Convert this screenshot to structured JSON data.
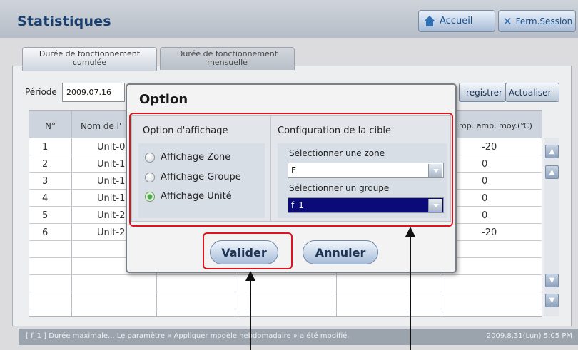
{
  "app": {
    "title": "Statistiques",
    "home_label": "Accueil",
    "logout_label": "Ferm.Session"
  },
  "tabs": [
    {
      "line1": "Durée de fonctionnement",
      "line2": "cumulée",
      "active": true
    },
    {
      "line1": "Durée de fonctionnement",
      "line2": "mensuelle",
      "active": false
    }
  ],
  "filter": {
    "period_label": "Période",
    "period_value": "2009.07.16",
    "register_label": "Enregistrer",
    "register_visible": "registrer",
    "refresh_label": "Actualiser"
  },
  "table": {
    "columns": [
      "N°",
      "Nom de l'",
      "mp. amb. moy.(℃)"
    ],
    "rows": [
      {
        "num": "1",
        "name": "Unit-0",
        "temp": "-20"
      },
      {
        "num": "2",
        "name": "Unit-1",
        "temp": "0"
      },
      {
        "num": "3",
        "name": "Unit-1",
        "temp": "0"
      },
      {
        "num": "4",
        "name": "Unit-1",
        "temp": "0"
      },
      {
        "num": "5",
        "name": "Unit-2",
        "temp": "0"
      },
      {
        "num": "6",
        "name": "Unit-2",
        "temp": "-20"
      }
    ]
  },
  "status": {
    "message": "[ f_1 ] Durée maximale... Le paramètre « Appliquer modèle hebdomadaire » a été modifié.",
    "datetime": "2009.8.31(Lun)  5:05 PM"
  },
  "modal": {
    "title": "Option",
    "display_heading": "Option d'affichage",
    "target_heading": "Configuration de la cible",
    "radios": [
      {
        "label": "Affichage Zone",
        "selected": false
      },
      {
        "label": "Affichage Groupe",
        "selected": false
      },
      {
        "label": "Affichage Unité",
        "selected": true
      }
    ],
    "zone_label": "Sélectionner une zone",
    "zone_value": "F",
    "group_label": "Sélectionner un groupe",
    "group_value": "f_1",
    "ok_label": "Valider",
    "cancel_label": "Annuler"
  },
  "colors": {
    "title_text": "#1a3f6e",
    "highlight": "#e0121b",
    "selected_bg": "#0a0b78",
    "radio_on": "#4fa94a"
  },
  "icons": {
    "home": "home-icon",
    "logout": "close-icon",
    "scroll_top": "double-chevron-up-icon",
    "scroll_up": "chevron-up-icon",
    "scroll_down": "chevron-down-icon",
    "scroll_bottom": "double-chevron-down-icon"
  }
}
